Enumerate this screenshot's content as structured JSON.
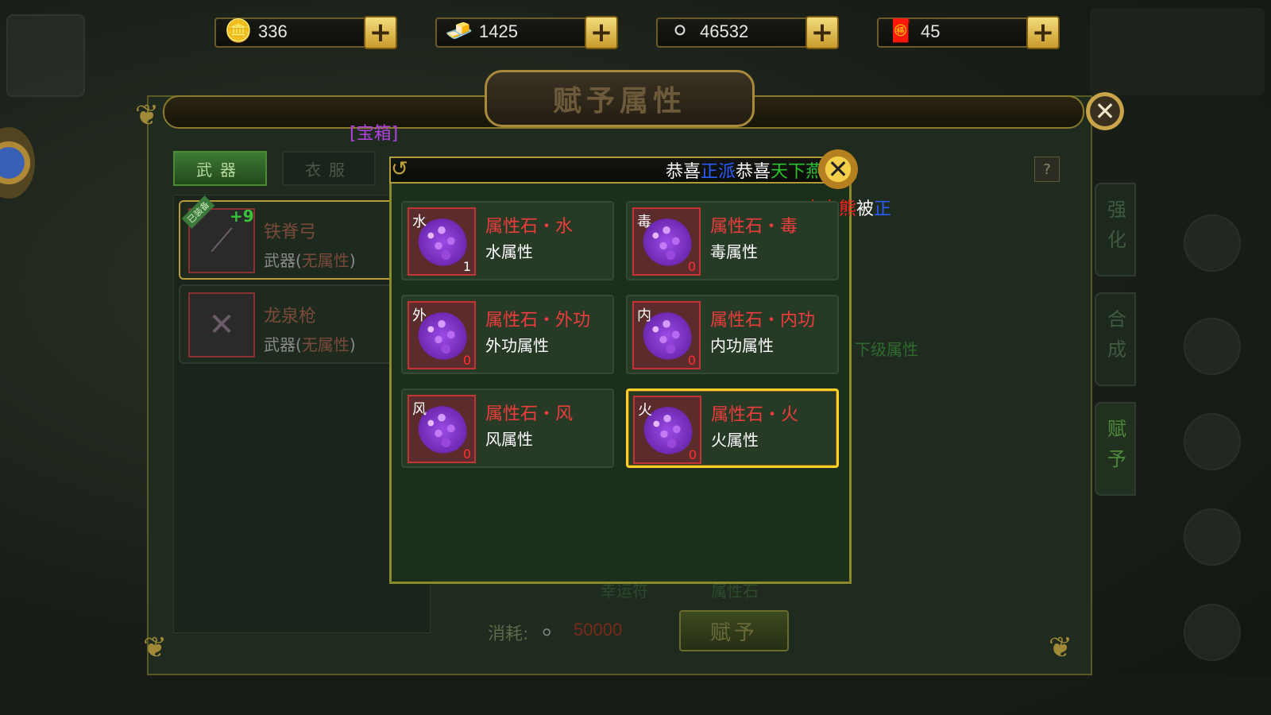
{
  "currencies": [
    {
      "icon": "gold-ingot-icon",
      "glyph": "🪙",
      "value": "336"
    },
    {
      "icon": "gold-bar-icon",
      "glyph": "🧈",
      "value": "1425"
    },
    {
      "icon": "silver-ingot-icon",
      "glyph": "⚪",
      "value": "46532"
    },
    {
      "icon": "gift-pouch-icon",
      "glyph": "🧧",
      "value": "45"
    }
  ],
  "plus_symbol": "+",
  "dialog": {
    "title": "赋予属性",
    "close_symbol": "✕",
    "treasure_label": "[宝箱]",
    "tabs": {
      "weapon": "武器",
      "clothes": "衣服"
    },
    "items": [
      {
        "name": "铁脊弓",
        "badge": "已装备",
        "level": "+9",
        "type_prefix": "武器(",
        "type_none": "无属性",
        "type_suffix": ")"
      },
      {
        "name": "龙泉枪",
        "type_prefix": "武器(",
        "type_none": "无属性",
        "type_suffix": ")"
      }
    ],
    "side_tabs": [
      "强化",
      "合成",
      "赋予"
    ],
    "help": "?",
    "next_level_attr": "下级属性",
    "bg_labels": {
      "lucky": "幸运符",
      "stone": "属性石"
    },
    "cost_label": "消耗:",
    "cost_value": "50000",
    "assign_button": "赋予"
  },
  "broadcast": {
    "line1": [
      {
        "text": "恭喜",
        "color": "white"
      },
      {
        "text": "正派",
        "color": "blue"
      },
      {
        "text": "恭喜",
        "color": "white"
      },
      {
        "text": "天下",
        "color": "green"
      },
      {
        "text": "燕西楼",
        "color": "green"
      }
    ],
    "line2": [
      {
        "text": "赤血熊",
        "color": "red"
      },
      {
        "text": "被",
        "color": "white"
      },
      {
        "text": "正",
        "color": "blue"
      }
    ]
  },
  "popup": {
    "close_symbol": "✕",
    "stones": [
      {
        "tag": "水",
        "name": "属性石・水",
        "attr": "水属性",
        "count": "1",
        "selected": false
      },
      {
        "tag": "毒",
        "name": "属性石・毒",
        "attr": "毒属性",
        "count": "0",
        "selected": false
      },
      {
        "tag": "外",
        "name": "属性石・外功",
        "attr": "外功属性",
        "count": "0",
        "selected": false
      },
      {
        "tag": "内",
        "name": "属性石・内功",
        "attr": "内功属性",
        "count": "0",
        "selected": false
      },
      {
        "tag": "风",
        "name": "属性石・风",
        "attr": "风属性",
        "count": "0",
        "selected": false
      },
      {
        "tag": "火",
        "name": "属性石・火",
        "attr": "火属性",
        "count": "0",
        "selected": true
      }
    ]
  }
}
